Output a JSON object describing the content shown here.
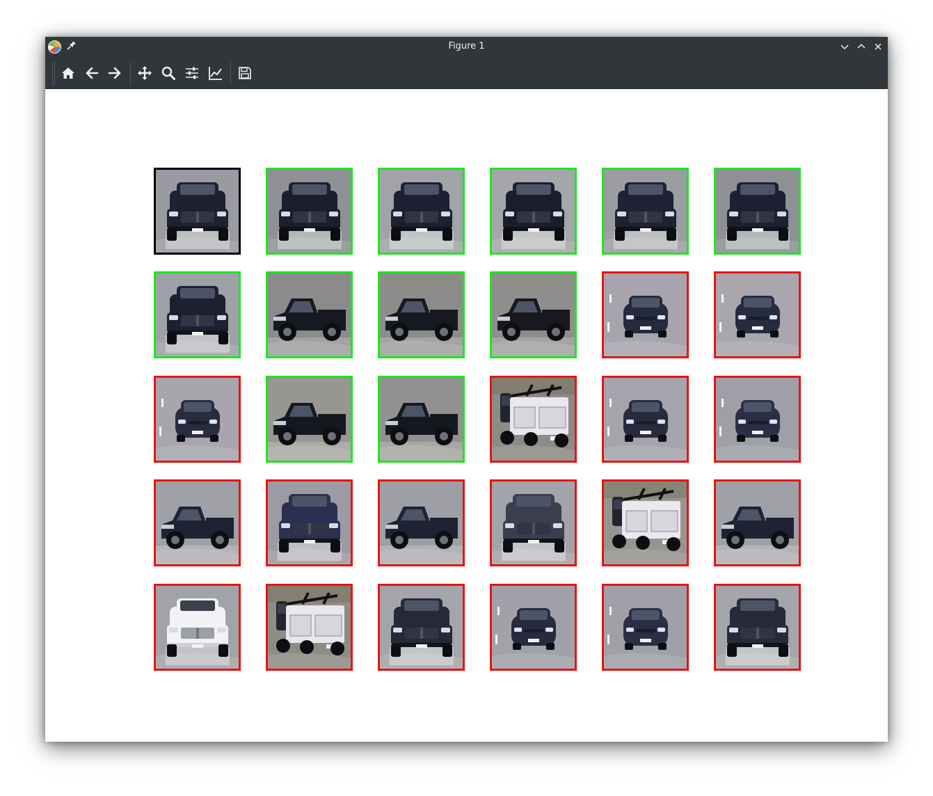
{
  "window": {
    "title": "Figure 1",
    "app_icon": "matplotlib-logo-icon",
    "pin_icon": "pin-icon",
    "controls": [
      "minimize-icon",
      "maximize-icon",
      "close-icon"
    ]
  },
  "toolbar": {
    "buttons": [
      {
        "name": "home-button",
        "icon": "home-icon"
      },
      {
        "name": "back-button",
        "icon": "arrow-left-icon"
      },
      {
        "name": "forward-button",
        "icon": "arrow-right-icon"
      },
      {
        "name": "pan-button",
        "icon": "move-icon"
      },
      {
        "name": "zoom-button",
        "icon": "magnifier-icon"
      },
      {
        "name": "subplots-button",
        "icon": "sliders-icon"
      },
      {
        "name": "edit-axes-button",
        "icon": "line-chart-icon"
      },
      {
        "name": "save-button",
        "icon": "floppy-disk-icon"
      }
    ]
  },
  "colors": {
    "query": "#000000",
    "match": "#1ee61e",
    "mismatch": "#e61414",
    "chrome": "#31363b"
  },
  "grid": {
    "rows": 5,
    "cols": 6,
    "cells": [
      {
        "status": "query",
        "vehicle": "pickup",
        "paint": "#1d2130",
        "bg": "#9a9ba2"
      },
      {
        "status": "match",
        "vehicle": "pickup",
        "paint": "#1b1f2c",
        "bg": "#8f9196"
      },
      {
        "status": "match",
        "vehicle": "pickup",
        "paint": "#1c2030",
        "bg": "#a2a3a8"
      },
      {
        "status": "match",
        "vehicle": "pickup",
        "paint": "#1a1e2b",
        "bg": "#a5a6ab"
      },
      {
        "status": "match",
        "vehicle": "pickup",
        "paint": "#1e2232",
        "bg": "#9c9da3"
      },
      {
        "status": "match",
        "vehicle": "pickup",
        "paint": "#1c2030",
        "bg": "#8e9095"
      },
      {
        "status": "match",
        "vehicle": "pickup",
        "paint": "#1c2030",
        "bg": "#a0a1a7"
      },
      {
        "status": "match",
        "vehicle": "pickup-side",
        "paint": "#16191f",
        "bg": "#8a8b8a"
      },
      {
        "status": "match",
        "vehicle": "pickup-side",
        "paint": "#16191f",
        "bg": "#8c8d8b"
      },
      {
        "status": "match",
        "vehicle": "pickup-side",
        "paint": "#17191f",
        "bg": "#8e8f8d"
      },
      {
        "status": "mismatch",
        "vehicle": "sedan",
        "paint": "#252a3d",
        "bg": "#a7a4ad"
      },
      {
        "status": "mismatch",
        "vehicle": "sedan",
        "paint": "#262b3f",
        "bg": "#a9a6ae"
      },
      {
        "status": "mismatch",
        "vehicle": "sedan",
        "paint": "#272c3f",
        "bg": "#a8a5ad"
      },
      {
        "status": "match",
        "vehicle": "pickup-side",
        "paint": "#15181f",
        "bg": "#969791"
      },
      {
        "status": "match",
        "vehicle": "pickup-side",
        "paint": "#15181f",
        "bg": "#919290"
      },
      {
        "status": "mismatch",
        "vehicle": "utility",
        "paint": "#e8e8ee",
        "bg": "#8d8b86"
      },
      {
        "status": "mismatch",
        "vehicle": "sedan",
        "paint": "#262b3e",
        "bg": "#a5a3ab"
      },
      {
        "status": "mismatch",
        "vehicle": "sedan",
        "paint": "#2a2f45",
        "bg": "#9fa0a7"
      },
      {
        "status": "mismatch",
        "vehicle": "pickup-side",
        "paint": "#1f2233",
        "bg": "#a0a1a6"
      },
      {
        "status": "mismatch",
        "vehicle": "pickup",
        "paint": "#2c3050",
        "bg": "#9c9ba3"
      },
      {
        "status": "mismatch",
        "vehicle": "pickup-side",
        "paint": "#1f2233",
        "bg": "#9e9fa5"
      },
      {
        "status": "mismatch",
        "vehicle": "pickup",
        "paint": "#3a3e4e",
        "bg": "#a3a4aa"
      },
      {
        "status": "mismatch",
        "vehicle": "utility",
        "paint": "#e9e9ef",
        "bg": "#96958f"
      },
      {
        "status": "mismatch",
        "vehicle": "pickup-side",
        "paint": "#1f2233",
        "bg": "#a0a1a6"
      },
      {
        "status": "mismatch",
        "vehicle": "pickup",
        "paint": "#f2f2f4",
        "bg": "#a2a3a8"
      },
      {
        "status": "mismatch",
        "vehicle": "utility",
        "paint": "#e7e7ec",
        "bg": "#8f8c86"
      },
      {
        "status": "mismatch",
        "vehicle": "pickup",
        "paint": "#262a36",
        "bg": "#a4a5aa"
      },
      {
        "status": "mismatch",
        "vehicle": "sedan",
        "paint": "#262b40",
        "bg": "#a1a2a9"
      },
      {
        "status": "mismatch",
        "vehicle": "sedan",
        "paint": "#2a2f46",
        "bg": "#a0a1a8"
      },
      {
        "status": "mismatch",
        "vehicle": "pickup",
        "paint": "#272b38",
        "bg": "#a4a5aa"
      }
    ]
  }
}
